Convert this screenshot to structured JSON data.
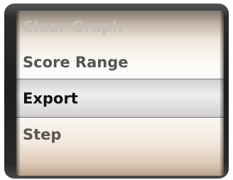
{
  "picker": {
    "items": [
      {
        "label": "Clear Graph",
        "selected": false
      },
      {
        "label": "Score Range",
        "selected": false
      },
      {
        "label": "Export",
        "selected": true
      },
      {
        "label": "Step",
        "selected": false
      }
    ],
    "selected_item": "Export"
  }
}
